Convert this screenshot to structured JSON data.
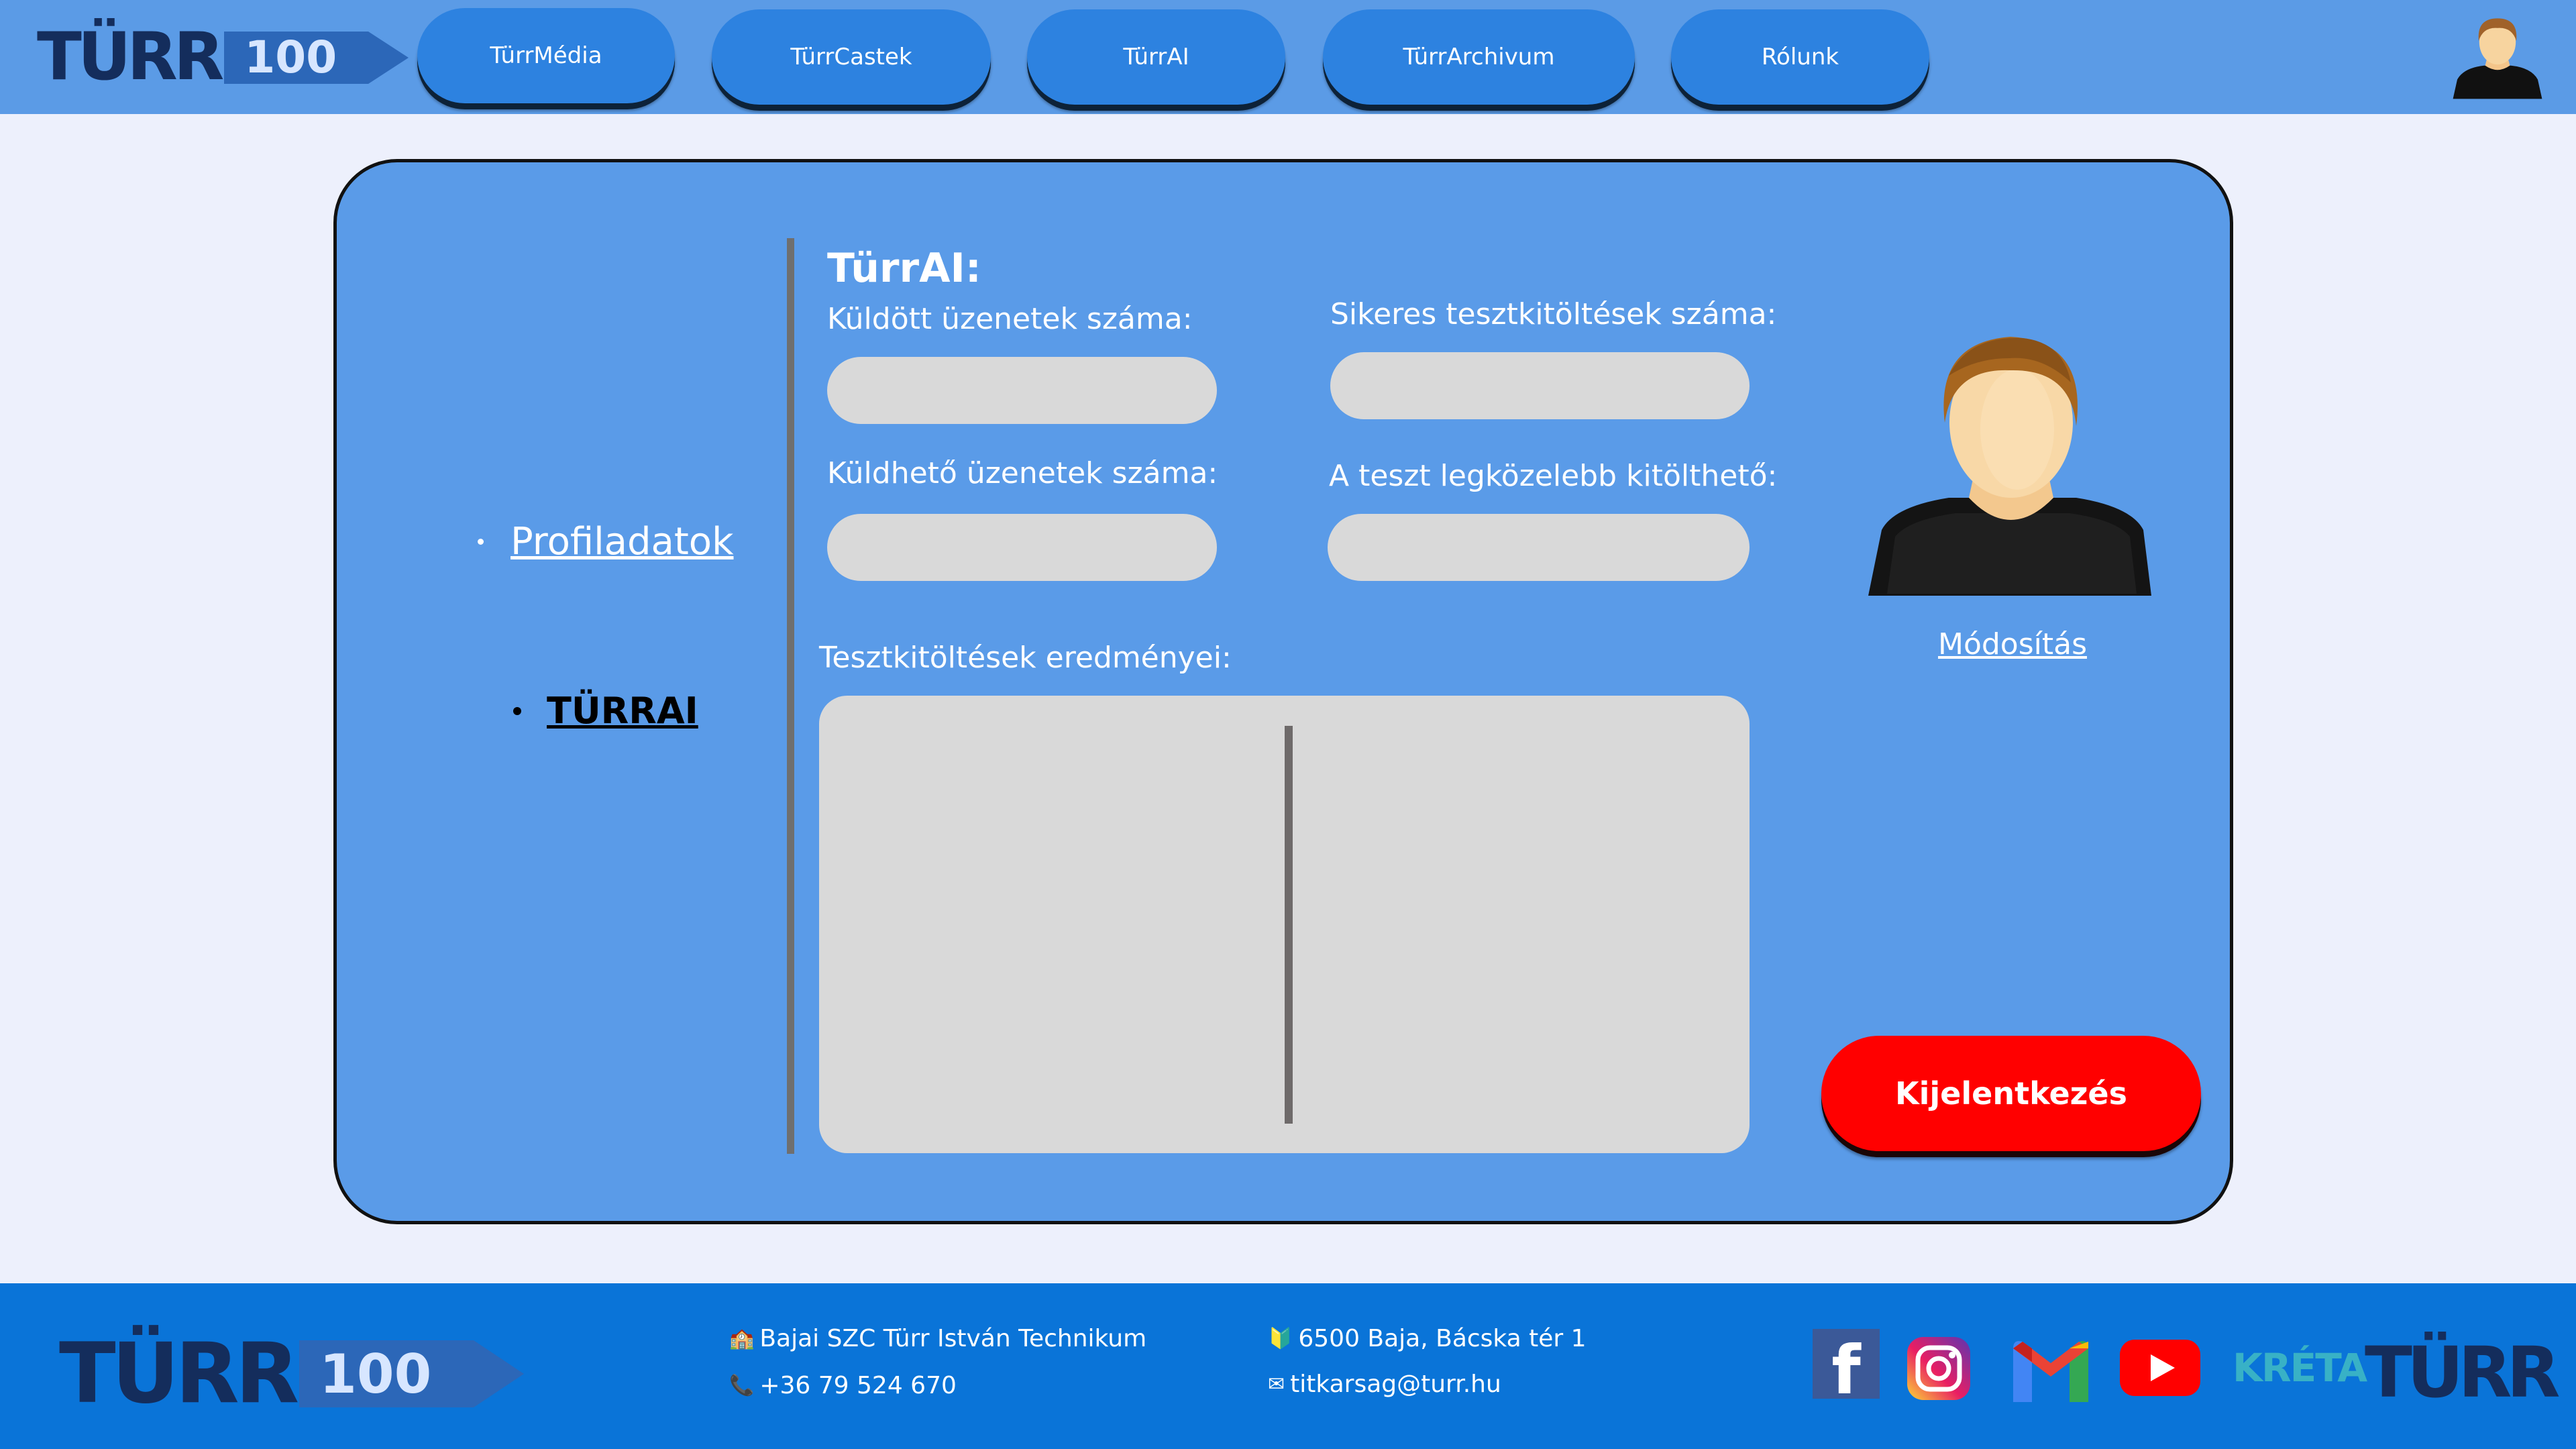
{
  "brand": {
    "logo_word": "TÜRR",
    "logo_number": "100"
  },
  "nav": {
    "items": [
      {
        "label": "TürrMédia"
      },
      {
        "label": "TürrCastek"
      },
      {
        "label": "TürrAI"
      },
      {
        "label": "TürrArchivum"
      },
      {
        "label": "Rólunk"
      }
    ]
  },
  "sidebar": {
    "items": [
      {
        "label": "Profiladatok",
        "active": false
      },
      {
        "label": "TÜRRAI",
        "active": true
      }
    ]
  },
  "main": {
    "section_title": "TürrAI:",
    "sent_messages_label": "Küldött üzenetek száma:",
    "sendable_messages_label": "Küldhető üzenetek száma:",
    "successful_tests_label": "Sikeres tesztkitöltések száma:",
    "next_test_label": "A teszt legközelebb kitölthető:",
    "results_label": "Tesztkitöltések eredményei:",
    "sent_messages_value": "",
    "sendable_messages_value": "",
    "successful_tests_value": "",
    "next_test_value": ""
  },
  "profile": {
    "modify_label": "Módosítás",
    "logout_label": "Kijelentkezés"
  },
  "footer": {
    "school": "Bajai SZC Türr István Technikum",
    "phone": "+36 79 524 670",
    "address": "6500 Baja, Bácska tér 1",
    "email": "titkarsag@turr.hu",
    "kreta_label": "KRÉTA",
    "facebook_letter": "f",
    "gmail_letter": "M"
  },
  "colors": {
    "header_bg": "#5b9be6",
    "page_bg": "#edf0fc",
    "panel_bg": "#5a9be8",
    "nav_button": "#2d82e0",
    "field_bg": "#d9d9d9",
    "logout_bg": "#ff0000",
    "footer_bg": "#0a74d8",
    "logo_dark": "#142d5c"
  },
  "icons": {
    "school": "school-building-icon",
    "phone": "phone-icon",
    "address": "location-badge-icon",
    "email": "envelope-icon",
    "facebook": "facebook-icon",
    "instagram": "instagram-icon",
    "gmail": "gmail-icon",
    "youtube": "youtube-icon",
    "kreta": "kreta-icon"
  }
}
